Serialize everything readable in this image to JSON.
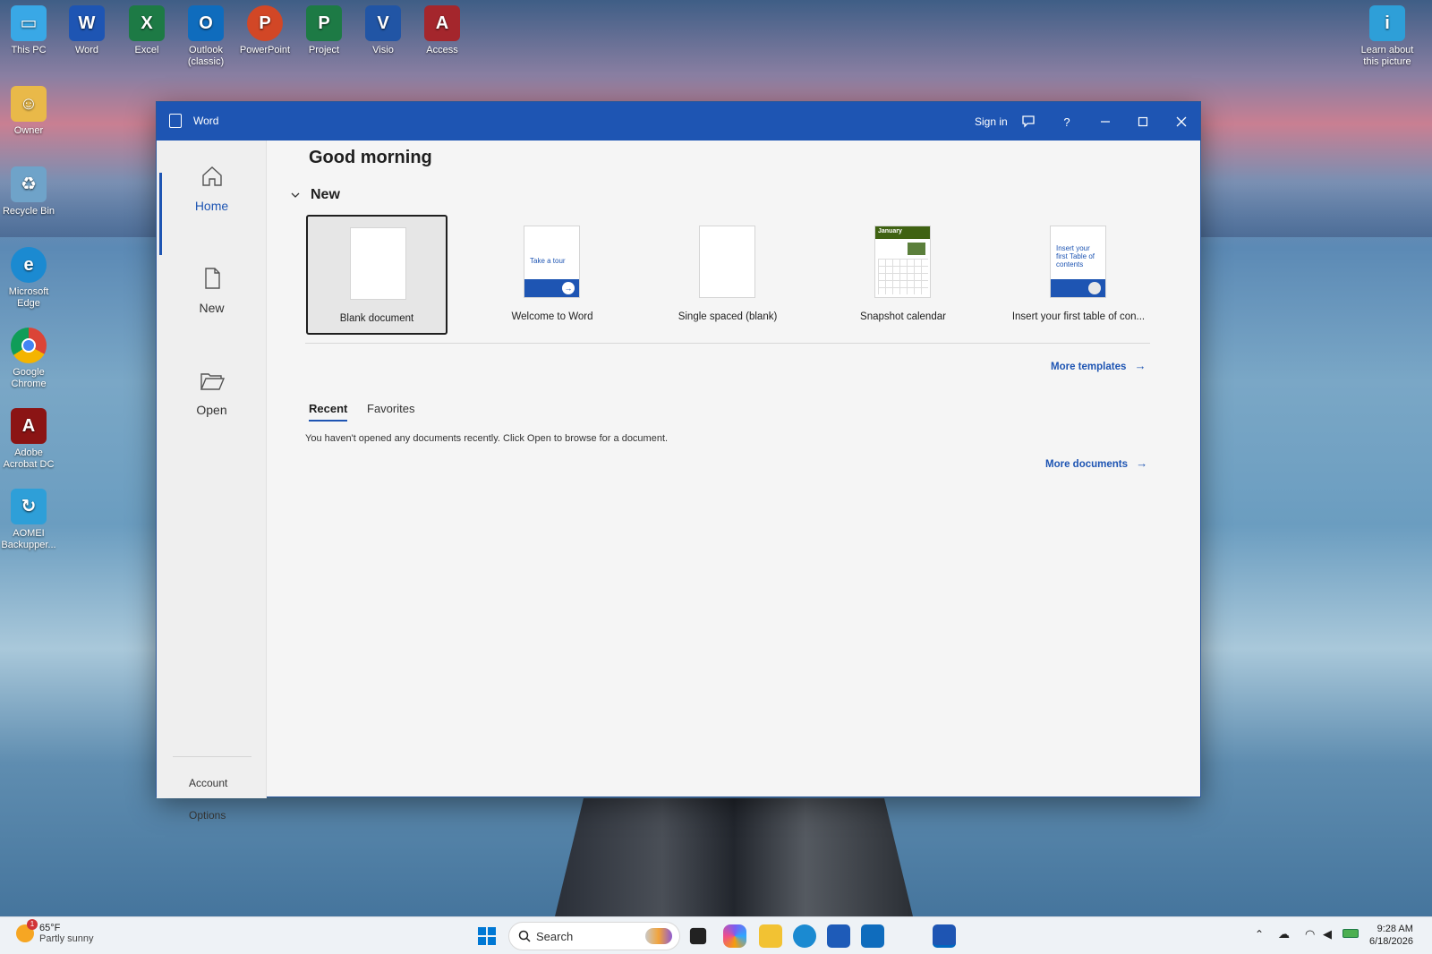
{
  "desktop": {
    "top_icons": [
      {
        "label": "This PC",
        "icon": "monitor-icon",
        "color": "#39a8e6"
      },
      {
        "label": "Word",
        "icon": "word-icon",
        "color": "#1e55b3"
      },
      {
        "label": "Excel",
        "icon": "excel-icon",
        "color": "#1d7a45"
      },
      {
        "label": "Outlook (classic)",
        "icon": "outlook-icon",
        "color": "#0f6cbd"
      },
      {
        "label": "PowerPoint",
        "icon": "powerpoint-icon",
        "color": "#d24726"
      },
      {
        "label": "Project",
        "icon": "project-icon",
        "color": "#1d7a45"
      },
      {
        "label": "Visio",
        "icon": "visio-icon",
        "color": "#2155a5"
      },
      {
        "label": "Access",
        "icon": "access-icon",
        "color": "#a4262c"
      }
    ],
    "left_icons": [
      {
        "label": "Owner",
        "icon": "user-folder-icon",
        "color": "#e9b949"
      },
      {
        "label": "Recycle Bin",
        "icon": "recycle-bin-icon",
        "color": "#6fa3c9"
      },
      {
        "label": "Microsoft Edge",
        "icon": "edge-icon",
        "color": "#1b8ad1"
      },
      {
        "label": "Google Chrome",
        "icon": "chrome-icon",
        "color": "#db4437"
      },
      {
        "label": "Adobe Acrobat DC",
        "icon": "acrobat-icon",
        "color": "#8b1414"
      },
      {
        "label": "AOMEI Backupper...",
        "icon": "aomei-icon",
        "color": "#2e9fd8"
      }
    ],
    "learn_about": "Learn about this picture"
  },
  "window": {
    "title": "Word",
    "sign_in": "Sign in",
    "help": "?"
  },
  "sidebar": {
    "items": [
      {
        "label": "Home",
        "icon": "home-icon"
      },
      {
        "label": "New",
        "icon": "new-document-icon"
      },
      {
        "label": "Open",
        "icon": "open-folder-icon"
      }
    ],
    "account": "Account",
    "options": "Options"
  },
  "main": {
    "greeting": "Good morning",
    "new_section": "New",
    "templates": [
      {
        "label": "Blank document"
      },
      {
        "label": "Welcome to Word",
        "thumb_text": "Take a tour"
      },
      {
        "label": "Single spaced (blank)"
      },
      {
        "label": "Snapshot calendar",
        "thumb_text": "January"
      },
      {
        "label": "Insert your first table of con...",
        "thumb_text": "Insert your first Table of contents"
      }
    ],
    "more_templates": "More templates",
    "tabs": [
      "Recent",
      "Favorites"
    ],
    "empty_message": "You haven't opened any documents recently. Click Open to browse for a document.",
    "more_documents": "More documents"
  },
  "taskbar": {
    "weather_temp": "65°F",
    "weather_desc": "Partly sunny",
    "weather_badge": "1",
    "search_placeholder": "Search",
    "time": "9:28 AM",
    "date": "6/18/2026"
  },
  "colors": {
    "accent": "#1e55b3",
    "window_bg": "#f5f5f5",
    "taskbar_bg": "#eef2f6"
  }
}
